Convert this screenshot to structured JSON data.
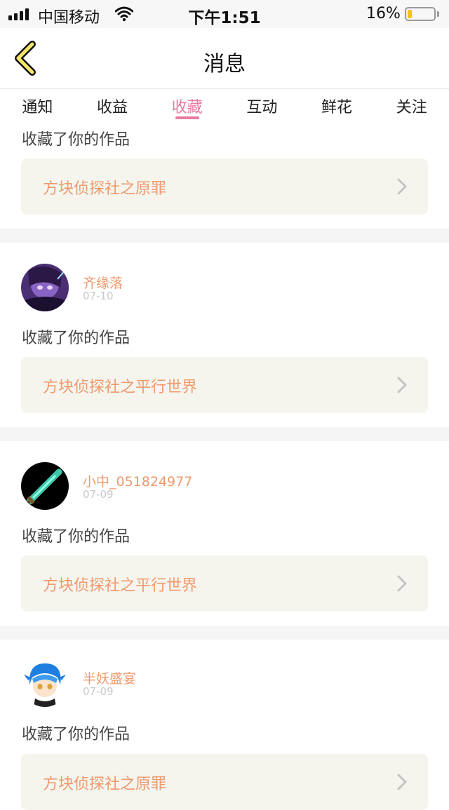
{
  "status_bar": {
    "carrier": "中国移动",
    "time": "下午1:51",
    "battery_percent": "16%",
    "battery_level": 0.16
  },
  "nav": {
    "title": "消息",
    "back_icon": "chevron-left-icon"
  },
  "tabs": [
    {
      "label": "通知",
      "active": false
    },
    {
      "label": "收益",
      "active": false
    },
    {
      "label": "收藏",
      "active": true
    },
    {
      "label": "互动",
      "active": false
    },
    {
      "label": "鲜花",
      "active": false
    },
    {
      "label": "关注",
      "active": false
    }
  ],
  "colors": {
    "accent": "#e87aa0",
    "work_title": "#ef9a6e",
    "card_bg": "#f5f5ee"
  },
  "feed": {
    "partial_item": {
      "action": "收藏了你的作品",
      "work_title": "方块侦探社之原罪"
    },
    "items": [
      {
        "username": "齐缘落",
        "date": "07-10",
        "action": "收藏了你的作品",
        "work_title": "方块侦探社之平行世界"
      },
      {
        "username": "小中_051824977",
        "date": "07-09",
        "action": "收藏了你的作品",
        "work_title": "方块侦探社之平行世界"
      },
      {
        "username": "半妖盛宴",
        "date": "07-09",
        "action": "收藏了你的作品",
        "work_title": "方块侦探社之原罪"
      }
    ]
  }
}
